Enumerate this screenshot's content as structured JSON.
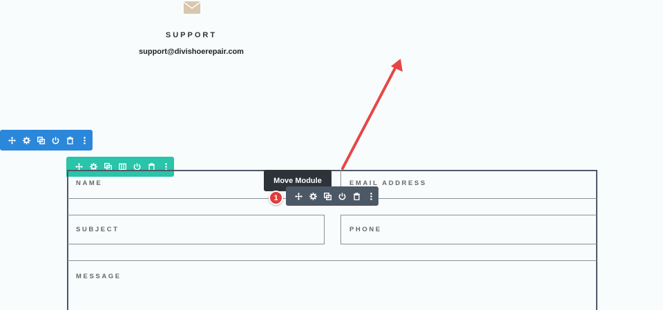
{
  "contact": {
    "icon": "envelope-icon",
    "title": "SUPPORT",
    "email": "support@divishoerepair.com"
  },
  "toolbars": {
    "section": {
      "color": "#2b87da",
      "icons": [
        "move-icon",
        "gear-icon",
        "duplicate-icon",
        "power-icon",
        "trash-icon",
        "more-icon"
      ]
    },
    "row": {
      "color": "#29c4a9",
      "icons": [
        "move-icon",
        "gear-icon",
        "duplicate-icon",
        "columns-icon",
        "power-icon",
        "trash-icon",
        "more-icon"
      ]
    },
    "module": {
      "color": "#4c5866",
      "icons": [
        "move-icon",
        "gear-icon",
        "duplicate-icon",
        "power-icon",
        "trash-icon",
        "more-icon"
      ]
    }
  },
  "tooltip": {
    "text": "Move Module"
  },
  "badge": {
    "text": "1",
    "color": "#e13b3b"
  },
  "form": {
    "fields": {
      "name": "NAME",
      "email": "EMAIL ADDRESS",
      "subject": "SUBJECT",
      "phone": "PHONE",
      "message": "MESSAGE"
    }
  },
  "annotation": {
    "arrow_color": "#e84646"
  }
}
